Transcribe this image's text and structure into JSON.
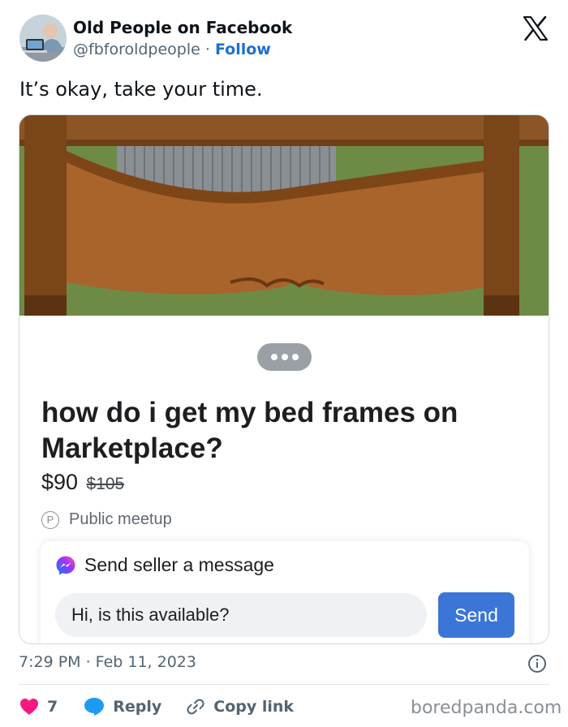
{
  "author": {
    "name": "Old People on Facebook",
    "handle": "@fbforoldpeople",
    "separator": "·",
    "follow_label": "Follow",
    "avatar_icon": "elderly-man-at-laptop-avatar"
  },
  "tweet": {
    "text": "It’s okay, take your time."
  },
  "marketplace": {
    "title": "how do i get my bed frames on Marketplace?",
    "price": "$90",
    "old_price": "$105",
    "meetup_badge": "P",
    "meetup_label": "Public meetup",
    "message_heading": "Send seller a message",
    "message_value": "Hi, is this available?",
    "send_label": "Send"
  },
  "footer": {
    "timestamp": "7:29 PM · Feb 11, 2023",
    "like_count": "7",
    "reply_label": "Reply",
    "copy_link_label": "Copy link",
    "watermark": "boredpanda.com"
  },
  "colors": {
    "follow_blue": "#1d6fd1",
    "like_red": "#f91880",
    "reply_blue": "#1d9bf0",
    "send_button": "#3b75d6"
  },
  "icons": [
    "x-logo-icon",
    "info-icon",
    "heart-icon",
    "speech-bubble-icon",
    "link-icon",
    "messenger-icon",
    "more-dots-icon"
  ]
}
